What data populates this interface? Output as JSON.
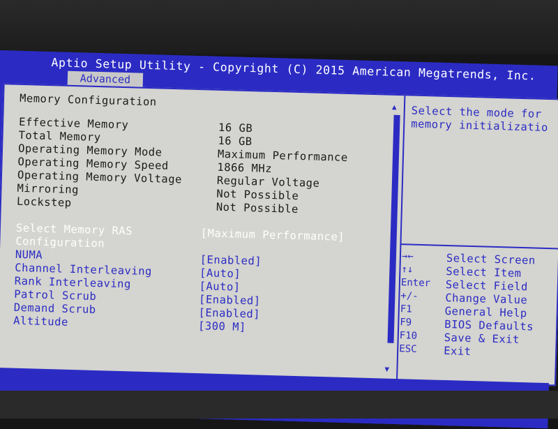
{
  "header": {
    "title": "Aptio Setup Utility - Copyright (C) 2015 American Megatrends, Inc.",
    "tab": "Advanced"
  },
  "main": {
    "section_title": "Memory Configuration",
    "info": [
      {
        "label": "Effective Memory",
        "value": "16 GB"
      },
      {
        "label": "Total Memory",
        "value": "16 GB"
      },
      {
        "label": "Operating Memory Mode",
        "value": "Maximum Performance"
      },
      {
        "label": "Operating Memory Speed",
        "value": "1866 MHz"
      },
      {
        "label": "Operating Memory Voltage",
        "value": "Regular Voltage"
      },
      {
        "label": "Mirroring",
        "value": "Not Possible"
      },
      {
        "label": "Lockstep",
        "value": "Not Possible"
      }
    ],
    "selected": {
      "label_1": "Select Memory RAS",
      "label_2": "Configuration",
      "value": "[Maximum Performance]"
    },
    "options": [
      {
        "label": "NUMA",
        "value": "[Enabled]"
      },
      {
        "label": "Channel Interleaving",
        "value": "[Auto]"
      },
      {
        "label": "Rank Interleaving",
        "value": "[Auto]"
      },
      {
        "label": "Patrol Scrub",
        "value": "[Enabled]"
      },
      {
        "label": "Demand Scrub",
        "value": "[Enabled]"
      },
      {
        "label": "Altitude",
        "value": "[300 M]"
      }
    ]
  },
  "help": {
    "line_1": "Select the mode for",
    "line_2": "memory initializatio"
  },
  "keys": [
    {
      "key": "→←",
      "desc": "Select Screen"
    },
    {
      "key": "↑↓",
      "desc": "Select Item"
    },
    {
      "key": "Enter",
      "desc": "Select Field"
    },
    {
      "key": "+/-",
      "desc": "Change Value"
    },
    {
      "key": "F1",
      "desc": "General Help"
    },
    {
      "key": "F9",
      "desc": "BIOS Defaults"
    },
    {
      "key": "F10",
      "desc": "Save & Exit"
    },
    {
      "key": "ESC",
      "desc": "Exit"
    }
  ],
  "colors": {
    "bios_blue": "#2b2bc4",
    "panel_gray": "#d4d4d0",
    "selected_text": "#ffffff"
  }
}
